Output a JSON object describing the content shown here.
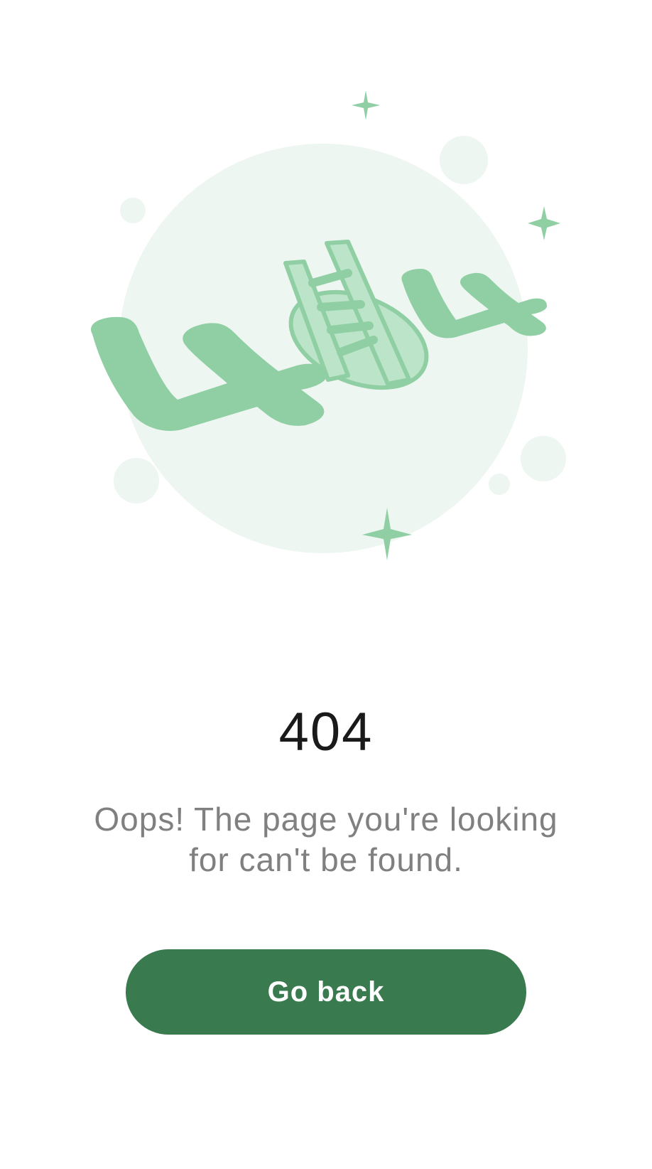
{
  "error": {
    "code": "404",
    "message": "Oops! The page you're looking for can't be found."
  },
  "actions": {
    "back_label": "Go back"
  },
  "illustration": {
    "icon": "404-ladder-hole-illustration",
    "colors": {
      "primary": "#8fcfa3",
      "light": "#bce4c8",
      "background": "#eaf5ee"
    }
  },
  "colors": {
    "button": "#3a7a4f",
    "title": "#1a1a1a",
    "message": "#808080"
  }
}
